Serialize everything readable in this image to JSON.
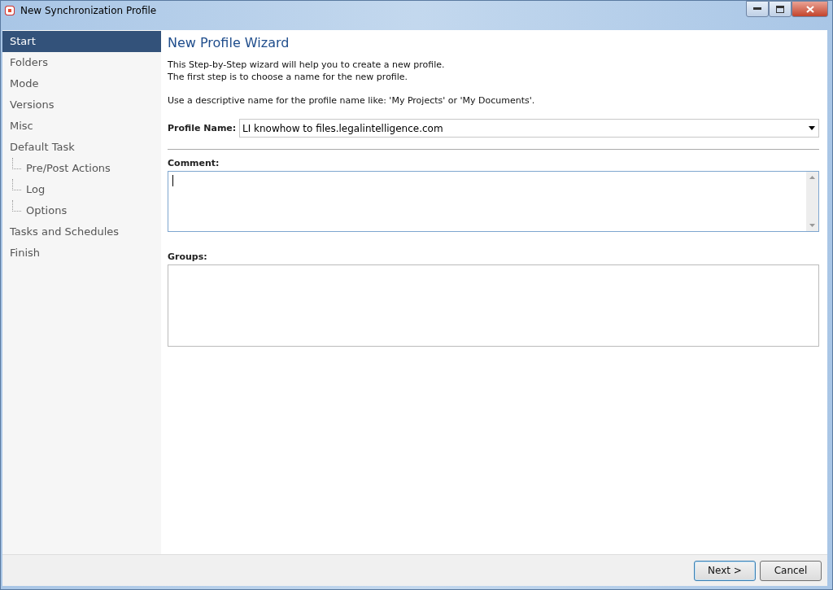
{
  "window": {
    "title": "New Synchronization Profile"
  },
  "sidebar": {
    "items": [
      {
        "label": "Start",
        "selected": true
      },
      {
        "label": "Folders",
        "selected": false
      },
      {
        "label": "Mode",
        "selected": false
      },
      {
        "label": "Versions",
        "selected": false
      },
      {
        "label": "Misc",
        "selected": false
      },
      {
        "label": "Default Task",
        "selected": false,
        "children": [
          {
            "label": "Pre/Post Actions",
            "selected": false
          },
          {
            "label": "Log",
            "selected": false
          },
          {
            "label": "Options",
            "selected": false
          }
        ]
      },
      {
        "label": "Tasks and Schedules",
        "selected": false
      },
      {
        "label": "Finish",
        "selected": false
      }
    ]
  },
  "page": {
    "heading": "New Profile Wizard",
    "intro": [
      "This Step-by-Step wizard will help you to create a new profile.",
      "The first step is to choose a name  for the new profile."
    ],
    "hint": "Use a descriptive name for the profile name like: 'My Projects' or 'My Documents'.",
    "profile_name": {
      "label": "Profile Name:",
      "value": "LI knowhow to files.legalintelligence.com"
    },
    "comment": {
      "label": "Comment:"
    },
    "groups": {
      "label": "Groups:"
    }
  },
  "buttons": [
    {
      "label": "Next >",
      "default": true
    },
    {
      "label": "Cancel",
      "default": false
    }
  ]
}
